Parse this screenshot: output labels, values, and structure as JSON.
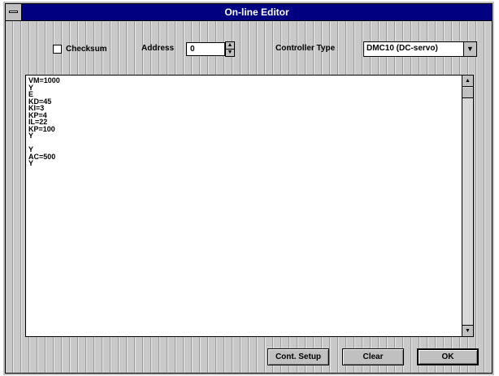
{
  "window": {
    "title": "On-line Editor"
  },
  "toolbar": {
    "checksum_label": "Checksum",
    "address_label": "Address",
    "address_value": "0",
    "controller_type_label": "Controller Type",
    "controller_type_value": "DMC10 (DC-servo)"
  },
  "editor": {
    "text": "VM=1000\nY\nE\nKD=45\nKI=3\nKP=4\nIL=22\nKP=100\nY\n\nY\nAC=500\nY"
  },
  "buttons": {
    "setup_label": "Cont. Setup",
    "clear_label": "Clear",
    "ok_label": "OK"
  }
}
